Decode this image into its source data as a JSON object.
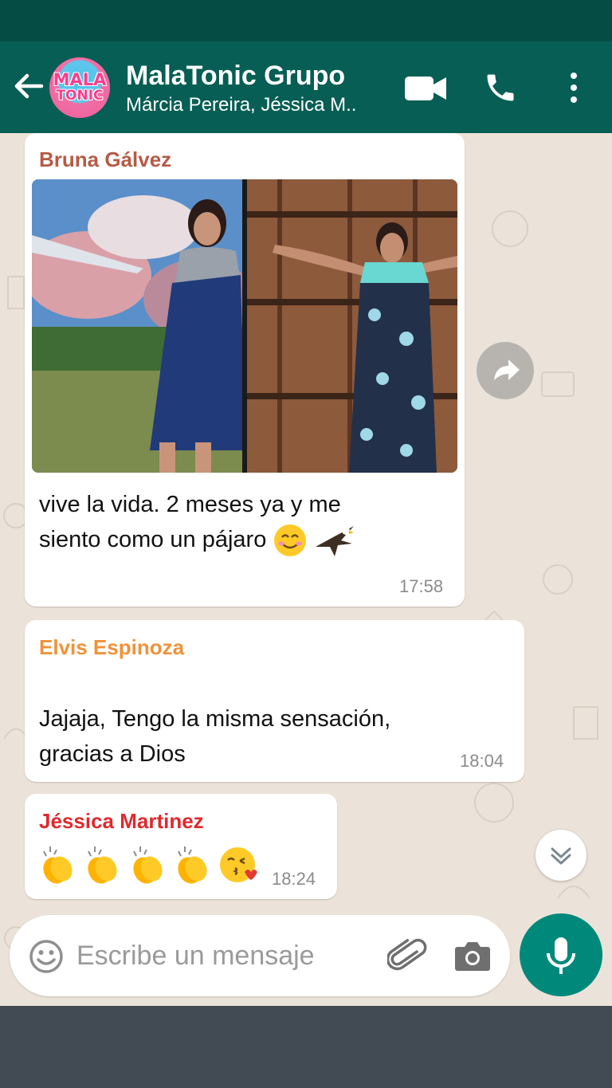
{
  "header": {
    "title": "MalaTonic Grupo",
    "subtitle": "Márcia Pereira, Jéssica M..",
    "avatar_text_1": "MALA",
    "avatar_text_2": "TONIC",
    "icons": [
      "back-arrow-icon",
      "video-call-icon",
      "phone-icon",
      "more-vert-icon"
    ]
  },
  "messages": [
    {
      "sender": "Bruna Gálvez",
      "sender_color": "#b55b45",
      "text_line1": "vive la vida. 2 meses ya y me",
      "text_line2": "siento como un pájaro",
      "emojis": [
        "smiling-face-icon",
        "eagle-icon"
      ],
      "time": "17:58",
      "has_photo": true
    },
    {
      "sender": "Elvis Espinoza",
      "sender_color": "#f0923a",
      "text_line1": "Jajaja, Tengo la misma sensación,",
      "text_line2": "gracias a Dios",
      "time": "18:04"
    },
    {
      "sender": "Jéssica Martinez",
      "sender_color": "#e0292e",
      "emojis": [
        "clapping-hands-icon",
        "clapping-hands-icon",
        "clapping-hands-icon",
        "clapping-hands-icon",
        "face-blowing-kiss-icon"
      ],
      "time": "18:24"
    }
  ],
  "composer": {
    "placeholder": "Escribe un mensaje",
    "icons": [
      "emoji-icon",
      "attach-icon",
      "camera-icon",
      "mic-icon"
    ]
  },
  "colors": {
    "header": "#075e54",
    "status_bar": "#054d44",
    "mic_button": "#00897b",
    "chat_background": "#ebe3d9"
  }
}
